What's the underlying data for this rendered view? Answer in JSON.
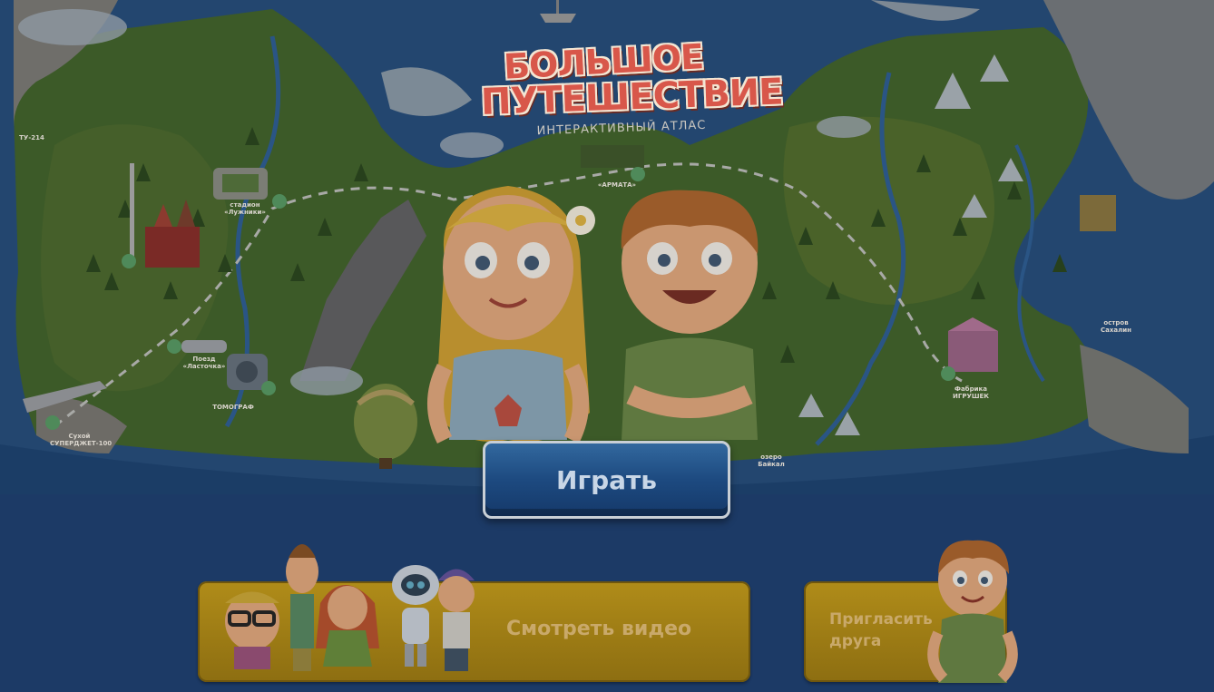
{
  "logo": {
    "line1": "БОЛЬШОЕ",
    "line2": "ПУТЕШЕСТВИЕ",
    "subtitle": "ИНТЕРАКТИВНЫЙ АТЛАС"
  },
  "map_labels": {
    "tomograf": "ТОМОГРАФ",
    "factory": "Фабрика ИГРУШЕК",
    "armata": "«АРМАТА»",
    "island": "остров Сахалин",
    "baikal": "озеро Байкал",
    "superjet": "Сухой СУПЕРДЖЕТ-100",
    "train": "Поезд «Ласточка»",
    "stadium": "стадион «Лужники»",
    "plane": "ТУ-214"
  },
  "buttons": {
    "play": "Играть",
    "watch_video": "Смотреть видео",
    "invite_friend": "Пригласить друга"
  },
  "colors": {
    "background": "#1c3a66",
    "play_button": "#1d4a80",
    "panel": "#9c7b14",
    "logo_red": "#d8574a"
  }
}
